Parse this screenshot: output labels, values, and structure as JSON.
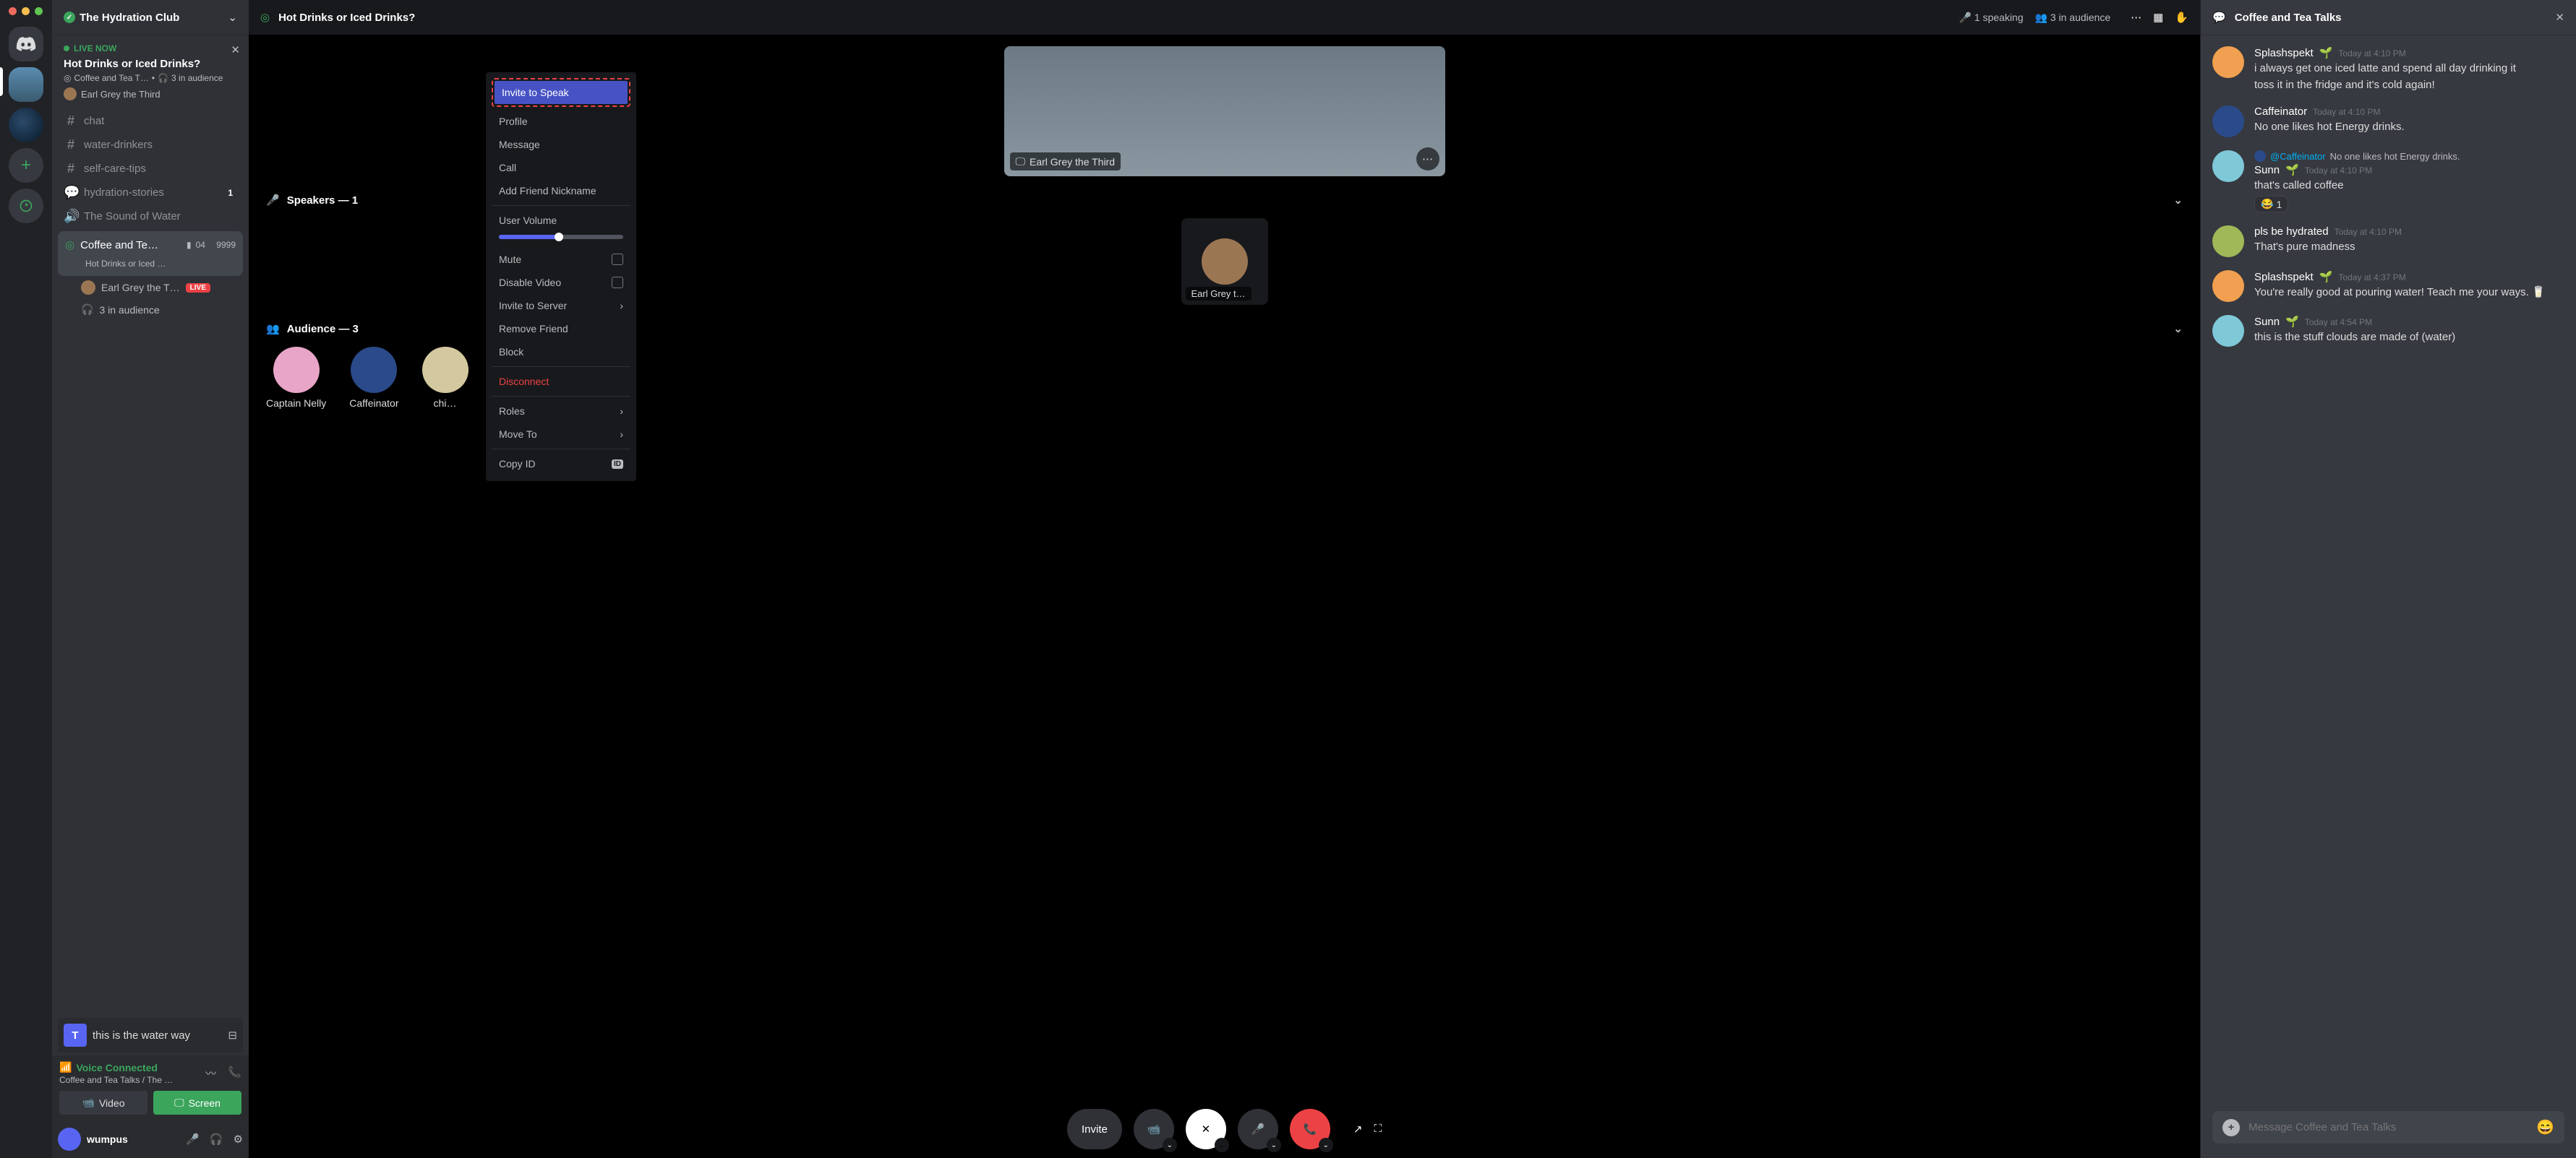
{
  "server": {
    "name": "The Hydration Club"
  },
  "live": {
    "label": "LIVE NOW",
    "title": "Hot Drinks or Iced Drinks?",
    "channel": "Coffee and Tea T…",
    "audience": "3 in audience",
    "host": "Earl Grey the Third"
  },
  "channels": {
    "chat": "chat",
    "water": "water-drinkers",
    "selfcare": "self-care-tips",
    "hydration": "hydration-stories",
    "hydration_badge": "1",
    "sound": "The Sound of Water",
    "stage_name": "Coffee and Te…",
    "stage_sub": "Hot Drinks or Iced …",
    "stage_count": "04",
    "stage_meta": "9999",
    "stage_member": "Earl Grey the T…",
    "stage_live": "LIVE",
    "stage_audience": "3 in audience"
  },
  "now_playing": {
    "cover": "T",
    "title": "this is the water way"
  },
  "voice": {
    "status": "Voice Connected",
    "sub": "Coffee and Tea Talks / The …",
    "video": "Video",
    "screen": "Screen"
  },
  "user": {
    "name": "wumpus"
  },
  "stage": {
    "title": "Hot Drinks or Iced Drinks?",
    "speaking": "1 speaking",
    "audience": "3 in audience",
    "video_label": "Earl Grey the Third",
    "speakers_head": "Speakers — 1",
    "speaker_name": "Earl Grey t…",
    "audience_head": "Audience — 3",
    "aud1": "Captain Nelly",
    "aud2": "Caffeinator",
    "aud3": "chi…",
    "invite": "Invite"
  },
  "context": {
    "invite_speak": "Invite to Speak",
    "profile": "Profile",
    "message": "Message",
    "call": "Call",
    "nickname": "Add Friend Nickname",
    "volume": "User Volume",
    "mute": "Mute",
    "disable_video": "Disable Video",
    "invite_server": "Invite to Server",
    "remove_friend": "Remove Friend",
    "block": "Block",
    "disconnect": "Disconnect",
    "roles": "Roles",
    "move": "Move To",
    "copy_id": "Copy ID"
  },
  "chat": {
    "title": "Coffee and Tea Talks",
    "placeholder": "Message Coffee and Tea Talks"
  },
  "messages": [
    {
      "author": "Splashspekt",
      "emoji": "🌱",
      "time": "Today at 4:10 PM",
      "text": "i always get one iced latte and spend all day drinking it",
      "text2": "toss it in the fridge and it's cold again!"
    },
    {
      "author": "Caffeinator",
      "time": "Today at 4:10 PM",
      "text": "No one likes hot Energy drinks."
    },
    {
      "reply_to": "@Caffeinator",
      "reply_text": "No one likes hot Energy drinks.",
      "author": "Sunn",
      "emoji": "🌱",
      "time": "Today at 4:10 PM",
      "text": "that's called coffee",
      "reaction": "😂",
      "reaction_count": "1"
    },
    {
      "author": "pls be hydrated",
      "time": "Today at 4:10 PM",
      "text": "That's pure madness"
    },
    {
      "author": "Splashspekt",
      "emoji": "🌱",
      "time": "Today at 4:37 PM",
      "text": "You're really good at pouring water! Teach me your ways. 🥛"
    },
    {
      "author": "Sunn",
      "emoji": "🌱",
      "time": "Today at 4:54 PM",
      "text": "this is the stuff clouds are made of (water)"
    }
  ]
}
